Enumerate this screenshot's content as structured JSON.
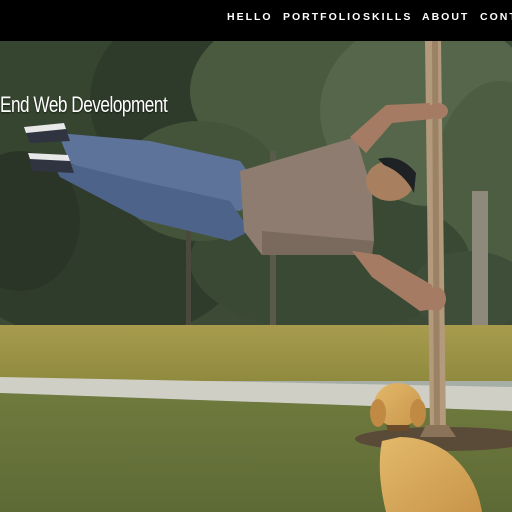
{
  "nav": {
    "items": [
      {
        "label": "HELLO"
      },
      {
        "label": "PORTFOLIO"
      },
      {
        "label": "SKILLS"
      },
      {
        "label": "ABOUT"
      },
      {
        "label": "CONTA"
      }
    ]
  },
  "hero": {
    "title": "End Web Development",
    "image_alt": "Man doing a human flag on a tree in a park with a yellow dog"
  },
  "colors": {
    "nav_bg": "#000000",
    "nav_text": "#ffffff",
    "title_text": "#ffffff"
  }
}
